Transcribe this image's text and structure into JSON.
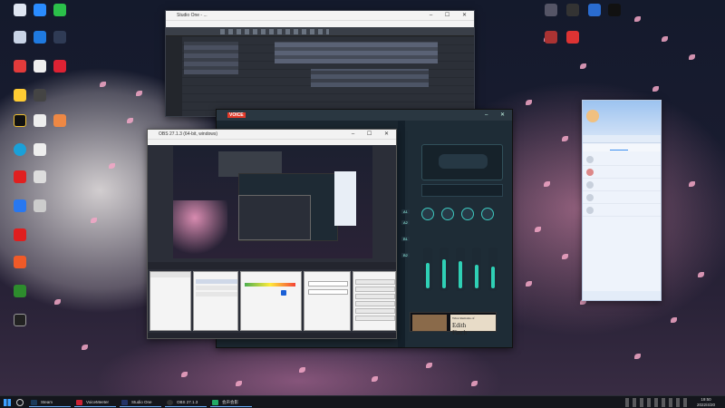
{
  "studio_one": {
    "title": "Studio One - ..."
  },
  "voicemeeter": {
    "brand": "VOICE"
  },
  "obs": {
    "title": "OBS 27.1.3 (64-bit, windows)"
  },
  "steam_card": {
    "subtitle": "What Remains of",
    "line1": "Edith",
    "line2": "Finch"
  },
  "taskbar": {
    "items": [
      "Steam",
      "VoiceMeeter",
      "Studio One",
      "OBS 27.1.3",
      "会声会影"
    ],
    "time": "19:50",
    "date": "2022/4/20"
  },
  "colors": {
    "accent": "#3a8ef0",
    "obs_bg": "#2b2e38",
    "voicemeeter_accent": "#2fd0b5",
    "wallpaper_petal": "#f3a7c7"
  }
}
